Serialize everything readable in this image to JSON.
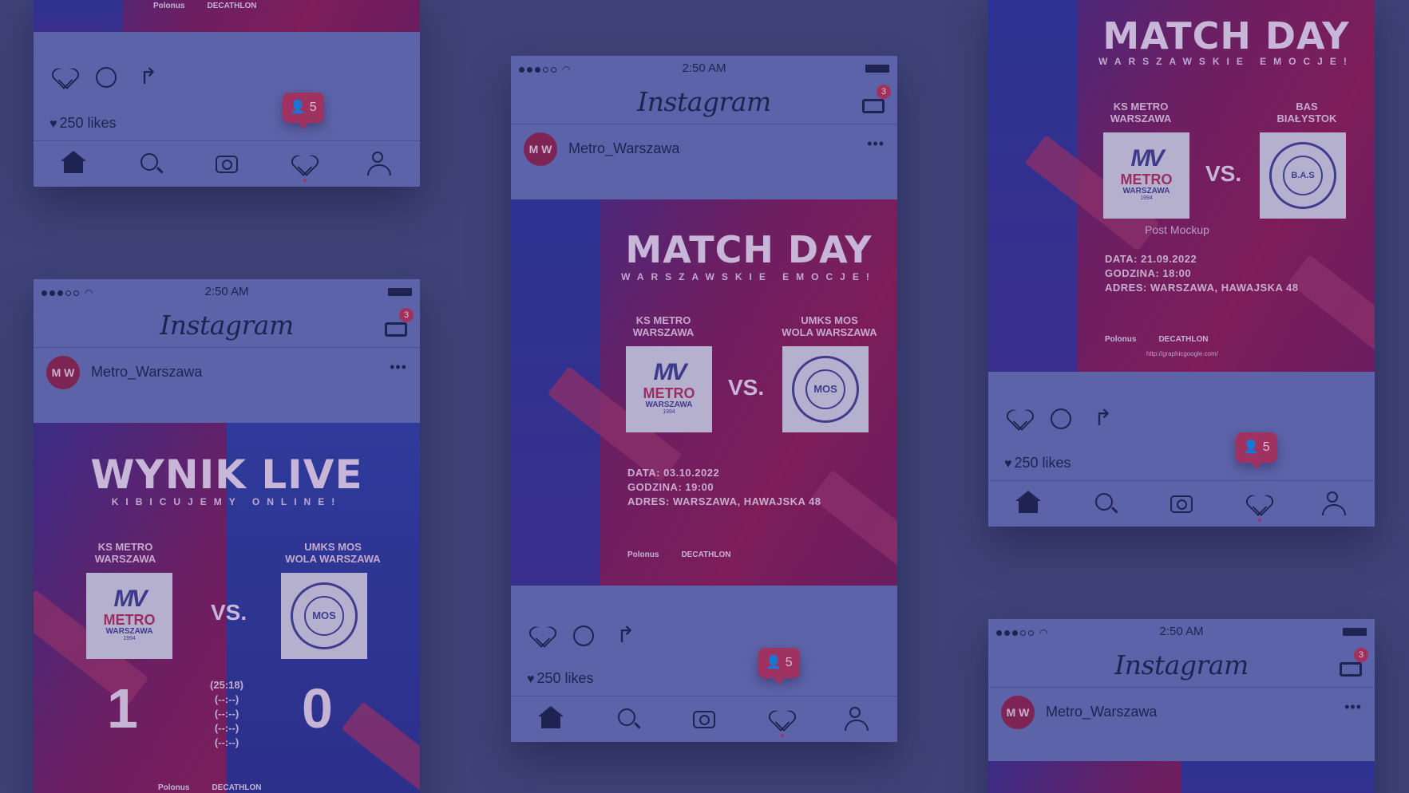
{
  "status_bar": {
    "time": "2:50 AM"
  },
  "instagram": {
    "logo_text": "Instagram",
    "inbox_count": "3"
  },
  "user": {
    "username": "Metro_Warszawa",
    "avatar_text": "M W",
    "more": "•••"
  },
  "post_actions": {
    "likes": "250 likes",
    "notification_count": "5"
  },
  "match_day_post": {
    "title": "MATCH DAY",
    "subtitle": "WARSZAWSKIE EMOCJE!",
    "home_team_line1": "KS METRO",
    "home_team_line2": "WARSZAWA",
    "away_team_line1": "UMKS MOS",
    "away_team_line2": "WOLA WARSZAWA",
    "vs": "VS.",
    "date": "DATA: 03.10.2022",
    "hour": "GODZINA: 19:00",
    "address": "ADRES: WARSZAWA, HAWAJSKA 48",
    "sponsor_1": "Polonus",
    "sponsor_2": "DECATHLON"
  },
  "match_day_post_2": {
    "title": "MATCH DAY",
    "subtitle": "WARSZAWSKIE EMOCJE!",
    "home_team_line1": "KS METRO",
    "home_team_line2": "WARSZAWA",
    "away_team_line1": "BAS",
    "away_team_line2": "BIAŁYSTOK",
    "vs": "VS.",
    "caption": "Post Mockup",
    "date": "DATA: 21.09.2022",
    "hour": "GODZINA: 18:00",
    "address": "ADRES: WARSZAWA, HAWAJSKA 48",
    "url": "http://graphicgoogle.com/",
    "sponsor_1": "Polonus",
    "sponsor_2": "DECATHLON"
  },
  "wynik_post": {
    "title": "WYNIK LIVE",
    "subtitle": "KIBICUJEMY ONLINE!",
    "home_team_line1": "KS METRO",
    "home_team_line2": "WARSZAWA",
    "away_team_line1": "UMKS MOS",
    "away_team_line2": "WOLA WARSZAWA",
    "vs": "VS.",
    "home_score": "1",
    "away_score": "0",
    "sets": [
      "(25:18)",
      "(--:--)",
      "(--:--)",
      "(--:--)",
      "(--:--)"
    ],
    "sponsor_1": "Polonus",
    "sponsor_2": "DECATHLON"
  },
  "logos": {
    "metro_mark": "MV",
    "metro_name": "METRO",
    "metro_city": "WARSZAWA",
    "metro_year": "1994",
    "mos_mark": "MOS",
    "bas_mark": "B.A.S"
  },
  "colors": {
    "background": "#3f4278",
    "card": "#5d63a8",
    "accent": "#a03262",
    "ink": "#1f2352"
  }
}
